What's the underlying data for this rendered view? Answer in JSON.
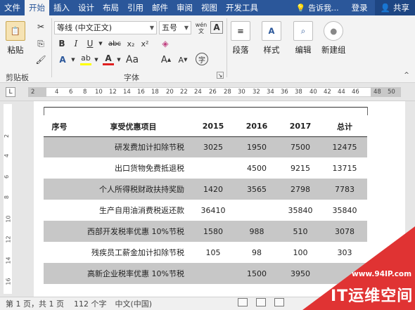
{
  "tabs": [
    "文件",
    "开始",
    "插入",
    "设计",
    "布局",
    "引用",
    "邮件",
    "审阅",
    "视图",
    "开发工具"
  ],
  "active_tab": "开始",
  "tell_me": "告诉我...",
  "login": "登录",
  "share": "共享",
  "ribbon": {
    "paste_label": "粘贴",
    "font_name": "等线 (中文正文)",
    "font_size": "五号",
    "wen": "wén",
    "groups": [
      "剪贴板",
      "字体"
    ],
    "paragraph_label": "段落",
    "styles_label": "样式",
    "editing_label": "编辑",
    "new_group_label": "新建组"
  },
  "ruler_numbers": [
    "2",
    "2",
    "4",
    "6",
    "8",
    "10",
    "12",
    "14",
    "16",
    "18",
    "20",
    "22",
    "24",
    "26",
    "28",
    "30",
    "32",
    "34",
    "36",
    "38",
    "40",
    "42",
    "44",
    "46",
    "48",
    "50"
  ],
  "vruler_numbers": [
    "2",
    "4",
    "6",
    "8",
    "10",
    "12",
    "14",
    "16"
  ],
  "table": {
    "headers": [
      "序号",
      "享受优惠项目",
      "2015",
      "2016",
      "2017",
      "总计"
    ],
    "rows": [
      {
        "seq": "",
        "item": "研发费加计扣除节税",
        "y2015": "3025",
        "y2016": "1950",
        "y2017": "7500",
        "total": "12475"
      },
      {
        "seq": "",
        "item": "出口货物免费抵退税",
        "y2015": "",
        "y2016": "4500",
        "y2017": "9215",
        "total": "13715"
      },
      {
        "seq": "",
        "item": "个人所得税财政扶持奖励",
        "y2015": "1420",
        "y2016": "3565",
        "y2017": "2798",
        "total": "7783"
      },
      {
        "seq": "",
        "item": "生产自用油消费税返还款",
        "y2015": "36410",
        "y2016": "",
        "y2017": "35840",
        "total": "35840"
      },
      {
        "seq": "",
        "item": "西部开发税率优惠 10%节税",
        "y2015": "1580",
        "y2016": "988",
        "y2017": "510",
        "total": "3078"
      },
      {
        "seq": "",
        "item": "残疾员工薪金加计扣除节税",
        "y2015": "105",
        "y2016": "98",
        "y2017": "100",
        "total": "303"
      },
      {
        "seq": "",
        "item": "高新企业税率优惠 10%节税",
        "y2015": "",
        "y2016": "1500",
        "y2017": "3950",
        "total": ""
      }
    ]
  },
  "status": {
    "page": "第 1 页，共 1 页",
    "words": "112 个字",
    "lang": "中文(中国)"
  },
  "watermark": {
    "url": "www.94IP.com",
    "brand": "IT运维空间"
  },
  "colors": {
    "tabbar": "#2b579a",
    "watermark": "#e03333"
  }
}
